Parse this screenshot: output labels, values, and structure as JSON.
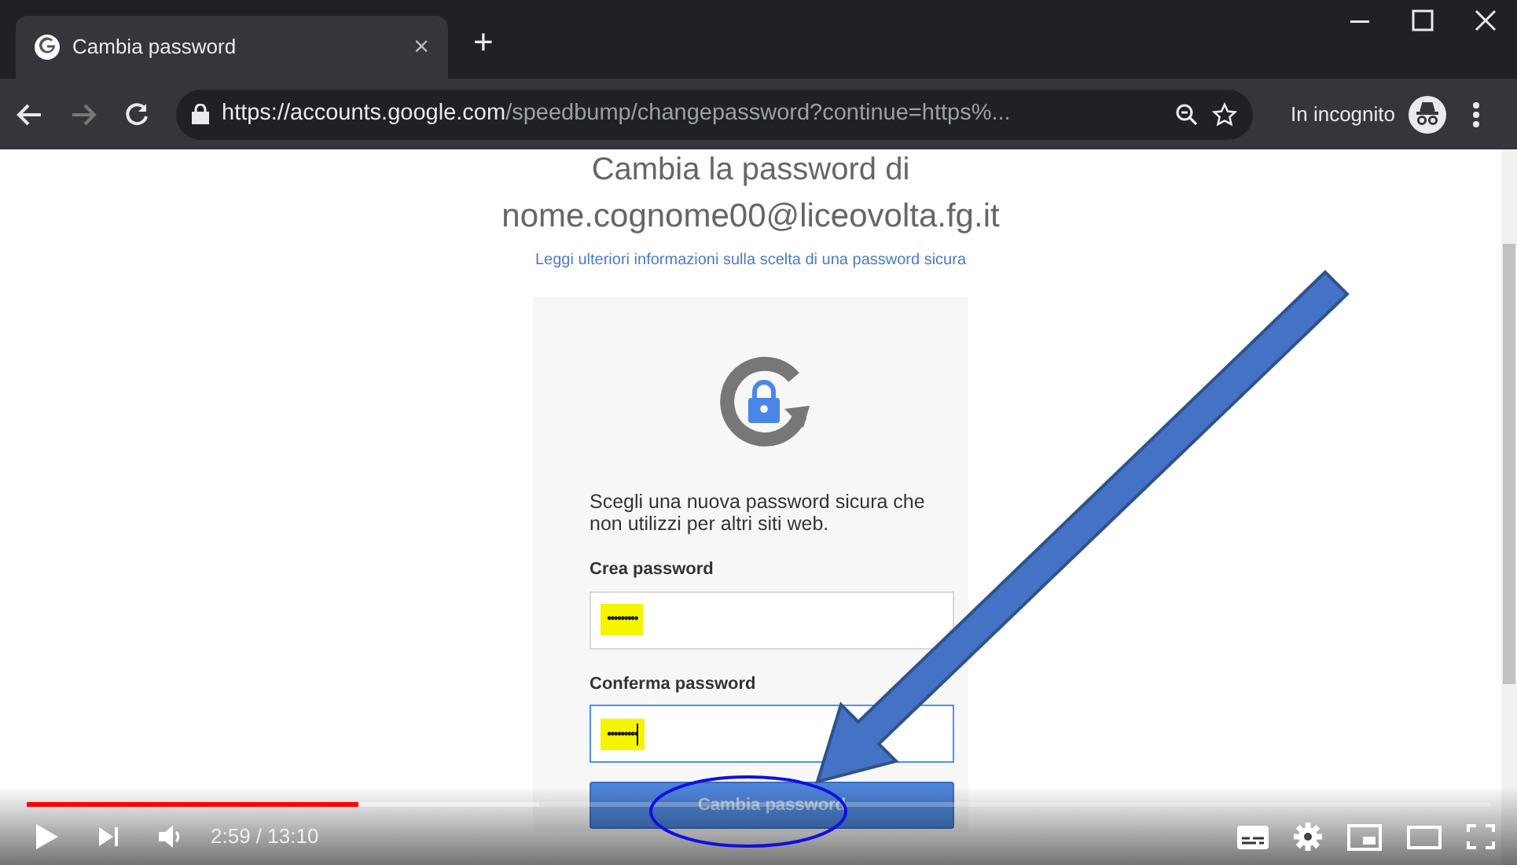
{
  "browser": {
    "tab": {
      "title": "Cambia password",
      "close": "×",
      "selected": true
    },
    "new_tab": "+",
    "address": {
      "host": "https://accounts.google.com",
      "path": "/speedbump/changepassword?continue=https%..."
    },
    "incognito": "In incognito"
  },
  "page": {
    "title": "Cambia la password di",
    "account": "nome.cognome00@liceovolta.fg.it",
    "info_link": "Leggi ulteriori informazioni sulla scelta di una password sicura",
    "instruction": "Scegli una nuova password sicura che non utilizzi per altri siti web.",
    "fields": [
      {
        "label": "Crea password",
        "value": "•••••••••",
        "highlighted": true,
        "focused": false
      },
      {
        "label": "Conferma password",
        "value": "•••••••••",
        "highlighted": true,
        "focused": true
      }
    ],
    "submit": "Cambia password"
  },
  "player": {
    "progress": {
      "level": 0.227
    },
    "time": "2:59 / 13:10"
  }
}
